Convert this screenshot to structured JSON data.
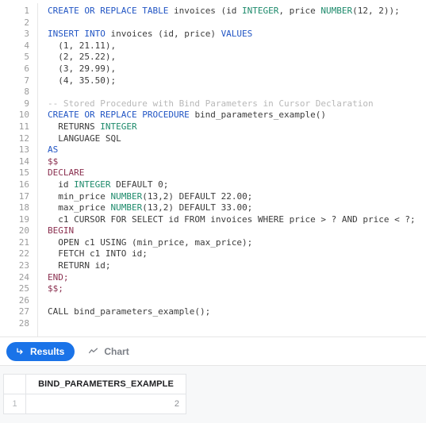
{
  "editor": {
    "language": "sql",
    "total_lines": 28,
    "line_numbers": [
      1,
      2,
      3,
      4,
      5,
      6,
      7,
      8,
      9,
      10,
      11,
      12,
      13,
      14,
      15,
      16,
      17,
      18,
      19,
      20,
      21,
      22,
      23,
      24,
      25,
      26,
      27,
      28
    ],
    "lines": [
      {
        "n": 1,
        "tokens": [
          {
            "t": "CREATE OR REPLACE TABLE ",
            "c": "k"
          },
          {
            "t": "invoices (id ",
            "c": "n"
          },
          {
            "t": "INTEGER",
            "c": "t"
          },
          {
            "t": ", price ",
            "c": "n"
          },
          {
            "t": "NUMBER",
            "c": "t"
          },
          {
            "t": "(12, 2));",
            "c": "n"
          }
        ]
      },
      {
        "n": 2,
        "tokens": []
      },
      {
        "n": 3,
        "tokens": [
          {
            "t": "INSERT INTO ",
            "c": "k"
          },
          {
            "t": "invoices (id, price) ",
            "c": "n"
          },
          {
            "t": "VALUES",
            "c": "k"
          }
        ]
      },
      {
        "n": 4,
        "tokens": [
          {
            "t": "  (1, 21.11),",
            "c": "n"
          }
        ]
      },
      {
        "n": 5,
        "tokens": [
          {
            "t": "  (2, 25.22),",
            "c": "n"
          }
        ]
      },
      {
        "n": 6,
        "tokens": [
          {
            "t": "  (3, 29.99),",
            "c": "n"
          }
        ]
      },
      {
        "n": 7,
        "tokens": [
          {
            "t": "  (4, 35.50);",
            "c": "n"
          }
        ]
      },
      {
        "n": 8,
        "tokens": []
      },
      {
        "n": 9,
        "tokens": [
          {
            "t": "-- Stored Procedure with Bind Parameters in Cursor Declaration",
            "c": "cm"
          }
        ]
      },
      {
        "n": 10,
        "tokens": [
          {
            "t": "CREATE OR REPLACE PROCEDURE ",
            "c": "k"
          },
          {
            "t": "bind_parameters_example()",
            "c": "n"
          }
        ]
      },
      {
        "n": 11,
        "tokens": [
          {
            "t": "  RETURNS ",
            "c": "n"
          },
          {
            "t": "INTEGER",
            "c": "t"
          }
        ]
      },
      {
        "n": 12,
        "tokens": [
          {
            "t": "  LANGUAGE SQL",
            "c": "n"
          }
        ]
      },
      {
        "n": 13,
        "tokens": [
          {
            "t": "AS",
            "c": "k"
          }
        ]
      },
      {
        "n": 14,
        "tokens": [
          {
            "t": "$$",
            "c": "b"
          }
        ]
      },
      {
        "n": 15,
        "tokens": [
          {
            "t": "DECLARE",
            "c": "b"
          }
        ]
      },
      {
        "n": 16,
        "tokens": [
          {
            "t": "  id ",
            "c": "n"
          },
          {
            "t": "INTEGER",
            "c": "t"
          },
          {
            "t": " DEFAULT 0;",
            "c": "n"
          }
        ]
      },
      {
        "n": 17,
        "tokens": [
          {
            "t": "  min_price ",
            "c": "n"
          },
          {
            "t": "NUMBER",
            "c": "t"
          },
          {
            "t": "(13,2) DEFAULT 22.00;",
            "c": "n"
          }
        ]
      },
      {
        "n": 18,
        "tokens": [
          {
            "t": "  max_price ",
            "c": "n"
          },
          {
            "t": "NUMBER",
            "c": "t"
          },
          {
            "t": "(13,2) DEFAULT 33.00;",
            "c": "n"
          }
        ]
      },
      {
        "n": 19,
        "tokens": [
          {
            "t": "  c1 CURSOR FOR SELECT id FROM invoices WHERE price > ? AND price < ?;",
            "c": "n"
          }
        ]
      },
      {
        "n": 20,
        "tokens": [
          {
            "t": "BEGIN",
            "c": "b"
          }
        ]
      },
      {
        "n": 21,
        "tokens": [
          {
            "t": "  OPEN c1 USING (min_price, max_price);",
            "c": "n"
          }
        ]
      },
      {
        "n": 22,
        "tokens": [
          {
            "t": "  FETCH c1 INTO id;",
            "c": "n"
          }
        ]
      },
      {
        "n": 23,
        "tokens": [
          {
            "t": "  RETURN id;",
            "c": "n"
          }
        ]
      },
      {
        "n": 24,
        "tokens": [
          {
            "t": "END;",
            "c": "b"
          }
        ]
      },
      {
        "n": 25,
        "tokens": [
          {
            "t": "$$;",
            "c": "b"
          }
        ]
      },
      {
        "n": 26,
        "tokens": []
      },
      {
        "n": 27,
        "tokens": [
          {
            "t": "CALL bind_parameters_example();",
            "c": "n"
          }
        ]
      },
      {
        "n": 28,
        "tokens": []
      }
    ]
  },
  "tabs": [
    {
      "label": "Results",
      "icon": "arrow-return-icon",
      "active": true
    },
    {
      "label": "Chart",
      "icon": "line-chart-icon",
      "active": false
    }
  ],
  "results_table": {
    "row_index_header": "",
    "columns": [
      "BIND_PARAMETERS_EXAMPLE"
    ],
    "rows": [
      {
        "index": "1",
        "cells": [
          "2"
        ]
      }
    ]
  },
  "colors": {
    "accent": "#1a73e8",
    "keyword": "#2155c4",
    "type": "#1d8a6b",
    "block_keyword": "#8a2f4f",
    "comment": "#b8b8b8",
    "text": "#3b3b3b",
    "results_bg": "#f7f8f9",
    "border": "#e2e4e7"
  }
}
